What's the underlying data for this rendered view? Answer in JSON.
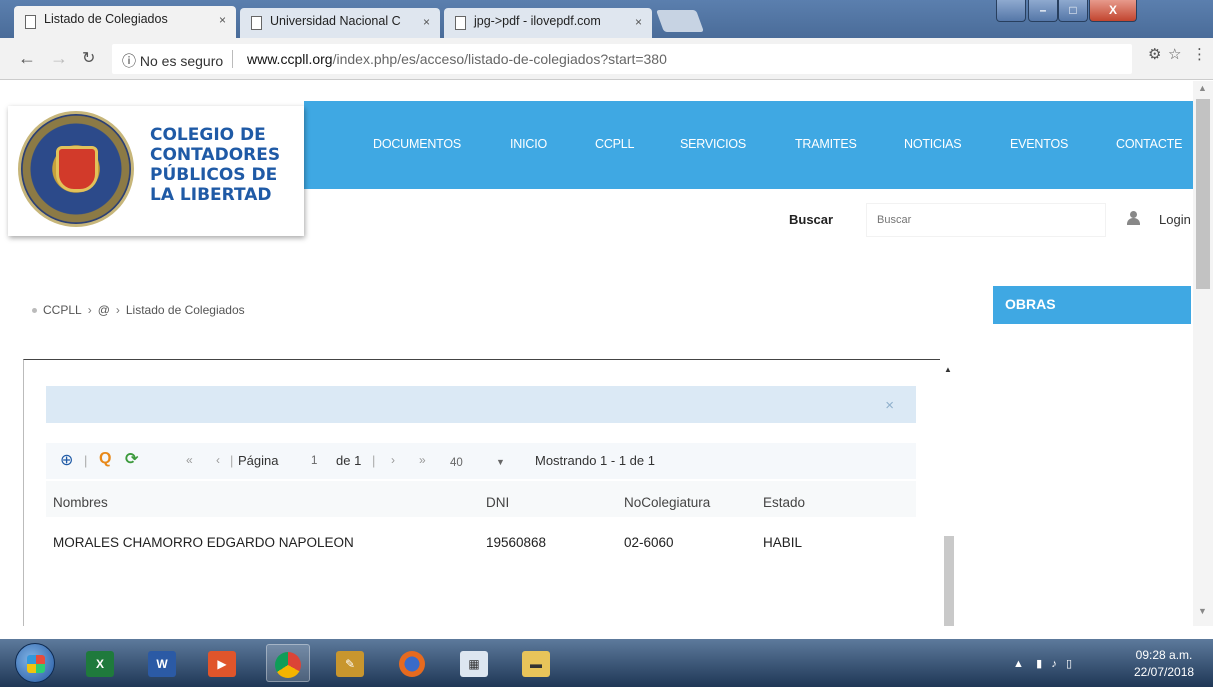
{
  "browser": {
    "tabs": [
      {
        "title": "Listado de Colegiados",
        "close": "×"
      },
      {
        "title": "Universidad Nacional C",
        "close": "×"
      },
      {
        "title": "jpg->pdf - ilovepdf.com",
        "close": "×"
      }
    ],
    "security_label": "No es seguro",
    "url_domain": "www.ccpll.org",
    "url_path": "/index.php/es/acceso/listado-de-colegiados?start=380"
  },
  "site": {
    "org_name_lines": [
      "COLEGIO DE",
      "CONTADORES",
      "PÚBLICOS DE",
      "LA LIBERTAD"
    ],
    "nav_items": [
      "DOCUMENTOS",
      "INICIO",
      "CCPLL",
      "SERVICIOS",
      "TRAMITES",
      "NOTICIAS",
      "EVENTOS",
      "CONTACTE"
    ],
    "search_label": "Buscar",
    "search_placeholder": "Buscar",
    "login_label": "Login",
    "breadcrumb": [
      "CCPLL",
      "@",
      "Listado de Colegiados"
    ],
    "sidebar_title": "OBRAS",
    "alert_close": "×"
  },
  "grid": {
    "pager": {
      "page_label": "Página",
      "page_value": "1",
      "of_label": "de 1",
      "page_size": "40",
      "showing": "Mostrando 1 - 1 de 1"
    },
    "columns": [
      "Nombres",
      "DNI",
      "NoColegiatura",
      "Estado"
    ],
    "rows": [
      [
        "MORALES CHAMORRO EDGARDO NAPOLEON",
        "19560868",
        "02-6060",
        "HABIL"
      ]
    ]
  },
  "taskbar": {
    "time": "09:28 a.m.",
    "date": "22/07/2018"
  },
  "colors": {
    "nav_blue": "#3fa8e3",
    "org_blue": "#1f5aa6",
    "alert_bg": "#dbe9f5"
  }
}
